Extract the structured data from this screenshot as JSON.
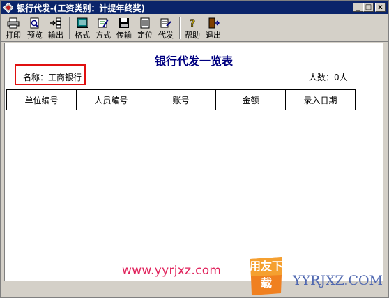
{
  "window": {
    "title": "银行代发-(工资类别：计提年终奖)",
    "minimize": "_",
    "maximize": "□",
    "close": "x"
  },
  "toolbar": {
    "print": "打印",
    "preview": "预览",
    "export": "输出",
    "format": "格式",
    "scheme": "方式",
    "transfer": "传输",
    "locate": "定位",
    "disburse": "代发",
    "help": "帮助",
    "exit": "退出"
  },
  "report": {
    "title": "银行代发一览表",
    "name_label": "名称：工商银行",
    "count_label": "人数：0人",
    "columns": [
      "单位编号",
      "人员编号",
      "账号",
      "金额",
      "录入日期"
    ]
  },
  "watermark": {
    "url": "www.yyrjxz.com",
    "logo_text": "用友下载",
    "site": "YYRJXZ.COM"
  }
}
